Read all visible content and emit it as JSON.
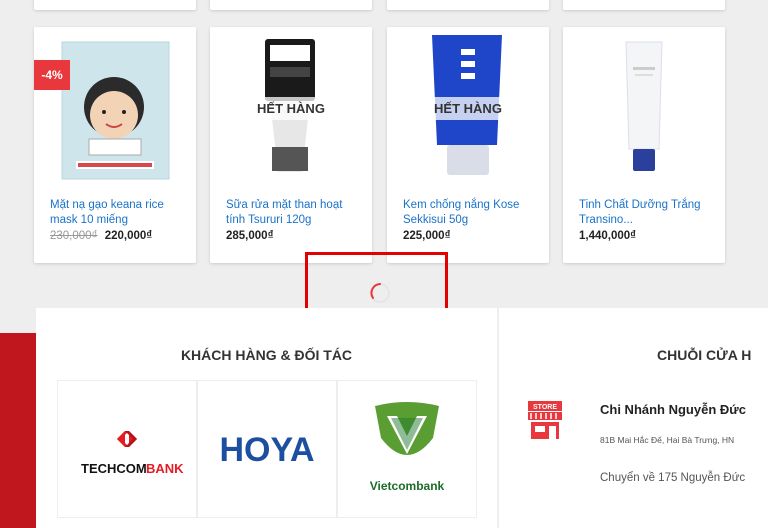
{
  "products": [
    {
      "name": "Mặt nạ gạo keana rice mask 10 miếng",
      "old_price": "230,000₫",
      "price": "220,000₫",
      "badge": "-4%",
      "status": ""
    },
    {
      "name": "Sữa rửa mặt than hoạt tính Tsururi 120g",
      "old_price": "",
      "price": "285,000₫",
      "badge": "",
      "status": "HẾT HÀNG"
    },
    {
      "name": "Kem chống nắng Kose Sekkisui 50g",
      "old_price": "",
      "price": "225,000₫",
      "badge": "",
      "status": "HẾT HÀNG"
    },
    {
      "name": "Tinh Chất Dưỡng Trắng Transino...",
      "old_price": "",
      "price": "1,440,000₫",
      "badge": "",
      "status": ""
    }
  ],
  "partners": {
    "title": "KHÁCH HÀNG & ĐỐI TÁC",
    "logos": [
      {
        "text_a": "TECHCOM",
        "text_b": "BANK"
      },
      {
        "text": "HOYA"
      },
      {
        "text": "Vietcombank"
      }
    ]
  },
  "stores": {
    "title": "CHUỖI CỬA H",
    "icon_label": "STORE",
    "branch": {
      "name": "Chi Nhánh Nguyễn Đức",
      "address": "81B Mai Hắc Đế, Hai Bà Trưng, HN",
      "note": "Chuyển về 175 Nguyễn Đức"
    }
  },
  "colors": {
    "accent_red": "#e30000",
    "badge_red": "#e8373d",
    "link_blue": "#1a73c8",
    "strip_red": "#c0161d"
  }
}
